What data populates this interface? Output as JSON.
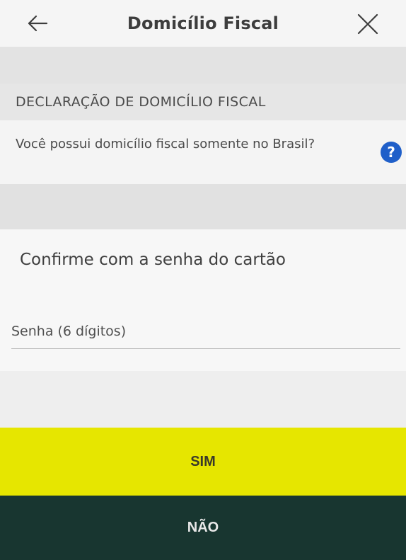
{
  "header": {
    "title": "Domicílio Fiscal",
    "back_icon": "arrow-left-icon",
    "close_icon": "close-icon"
  },
  "section": {
    "heading": "DECLARAÇÃO DE DOMICÍLIO FISCAL",
    "question": "Você possui domicílio fiscal somente no Brasil?",
    "help_icon": "help-icon",
    "help_glyph": "?"
  },
  "confirm": {
    "title": "Confirme com a senha do cartão",
    "password_placeholder": "Senha (6 dígitos)"
  },
  "actions": {
    "yes_label": "SIM",
    "no_label": "NÃO"
  },
  "colors": {
    "yes_button": "#e6e600",
    "no_button": "#183630",
    "help_icon": "#1f5fc9"
  }
}
